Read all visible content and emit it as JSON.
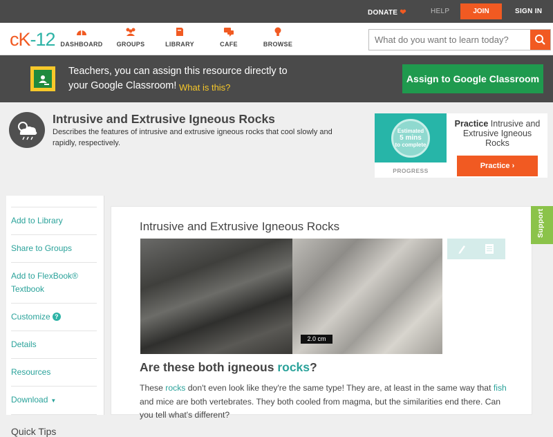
{
  "topbar": {
    "donate": "DONATE",
    "help": "HELP",
    "join": "JOIN",
    "signin": "SIGN IN"
  },
  "nav": {
    "logo_ck": "cK",
    "logo_num": "-12",
    "items": [
      {
        "label": "DASHBOARD",
        "icon": "dashboard-icon"
      },
      {
        "label": "GROUPS",
        "icon": "groups-icon"
      },
      {
        "label": "LIBRARY",
        "icon": "library-icon"
      },
      {
        "label": "CAFE",
        "icon": "cafe-icon"
      },
      {
        "label": "BROWSE",
        "icon": "browse-icon"
      }
    ],
    "search_placeholder": "What do you want to learn today?"
  },
  "banner": {
    "text": "Teachers, you can assign this resource directly to your Google Classroom!",
    "what": "What is this?",
    "button": "Assign to Google Classroom"
  },
  "hero": {
    "title": "Intrusive and Extrusive Igneous Rocks",
    "description": "Describes the features of intrusive and extrusive igneous rocks that cool slowly and rapidly, respectively."
  },
  "practice": {
    "estimated": "Estimated",
    "mins": "5 mins",
    "complete": "to complete",
    "progress": "PROGRESS",
    "text_bold": "Practice",
    "text_rest": "Intrusive and Extrusive Igneous Rocks",
    "button": "Practice"
  },
  "sidebar": {
    "items": [
      {
        "label": "Add to Library"
      },
      {
        "label": "Share to Groups"
      },
      {
        "label": "Add to FlexBook® Textbook"
      },
      {
        "label": "Customize"
      },
      {
        "label": "Details"
      },
      {
        "label": "Resources"
      },
      {
        "label": "Download"
      }
    ],
    "quick_tips": "Quick Tips"
  },
  "main": {
    "title": "Intrusive and Extrusive Igneous Rocks",
    "scale_label": "2.0 cm",
    "question_prefix": "Are these both igneous ",
    "question_link": "rocks",
    "question_suffix": "?",
    "para_1": "These ",
    "para_link1": "rocks",
    "para_2": " don't even look like they're the same type! They are, at least in the same way that ",
    "para_link2": "fish",
    "para_3": " and mice are both vertebrates. They both cooled from magma, but the similarities end there. Can you tell what's different?"
  },
  "support": "Support",
  "colors": {
    "accent": "#f15a22",
    "teal": "#2aa29a",
    "green": "#1f9a4e",
    "dark": "#4a4a4a"
  }
}
